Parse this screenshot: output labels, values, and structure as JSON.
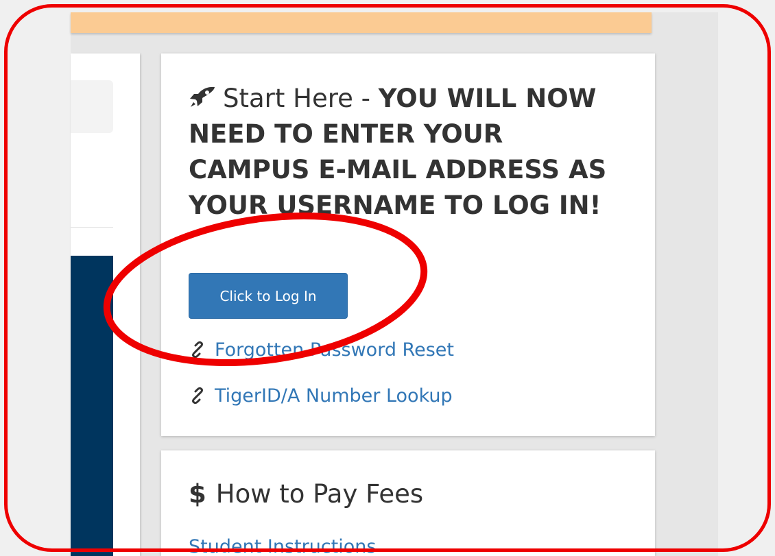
{
  "start_card": {
    "icon": "rocket-icon",
    "heading_lead": "Start Here - ",
    "heading_bold": "YOU WILL NOW NEED TO ENTER YOUR CAMPUS E-MAIL ADDRESS AS YOUR USERNAME TO LOG IN!",
    "login_button_label": "Click to Log In",
    "links": [
      {
        "icon": "link-icon",
        "label": "Forgotten Password Reset"
      },
      {
        "icon": "link-icon",
        "label": "TigerID/A Number Lookup"
      }
    ]
  },
  "fees_card": {
    "icon": "dollar-icon",
    "icon_glyph": "$",
    "heading": "How to Pay Fees",
    "first_item": "Student Instructions"
  },
  "colors": {
    "banner": "#fbcb93",
    "navy": "#00355e",
    "button": "#3277b6",
    "link": "#3277b6",
    "annotation": "#ee0000"
  }
}
